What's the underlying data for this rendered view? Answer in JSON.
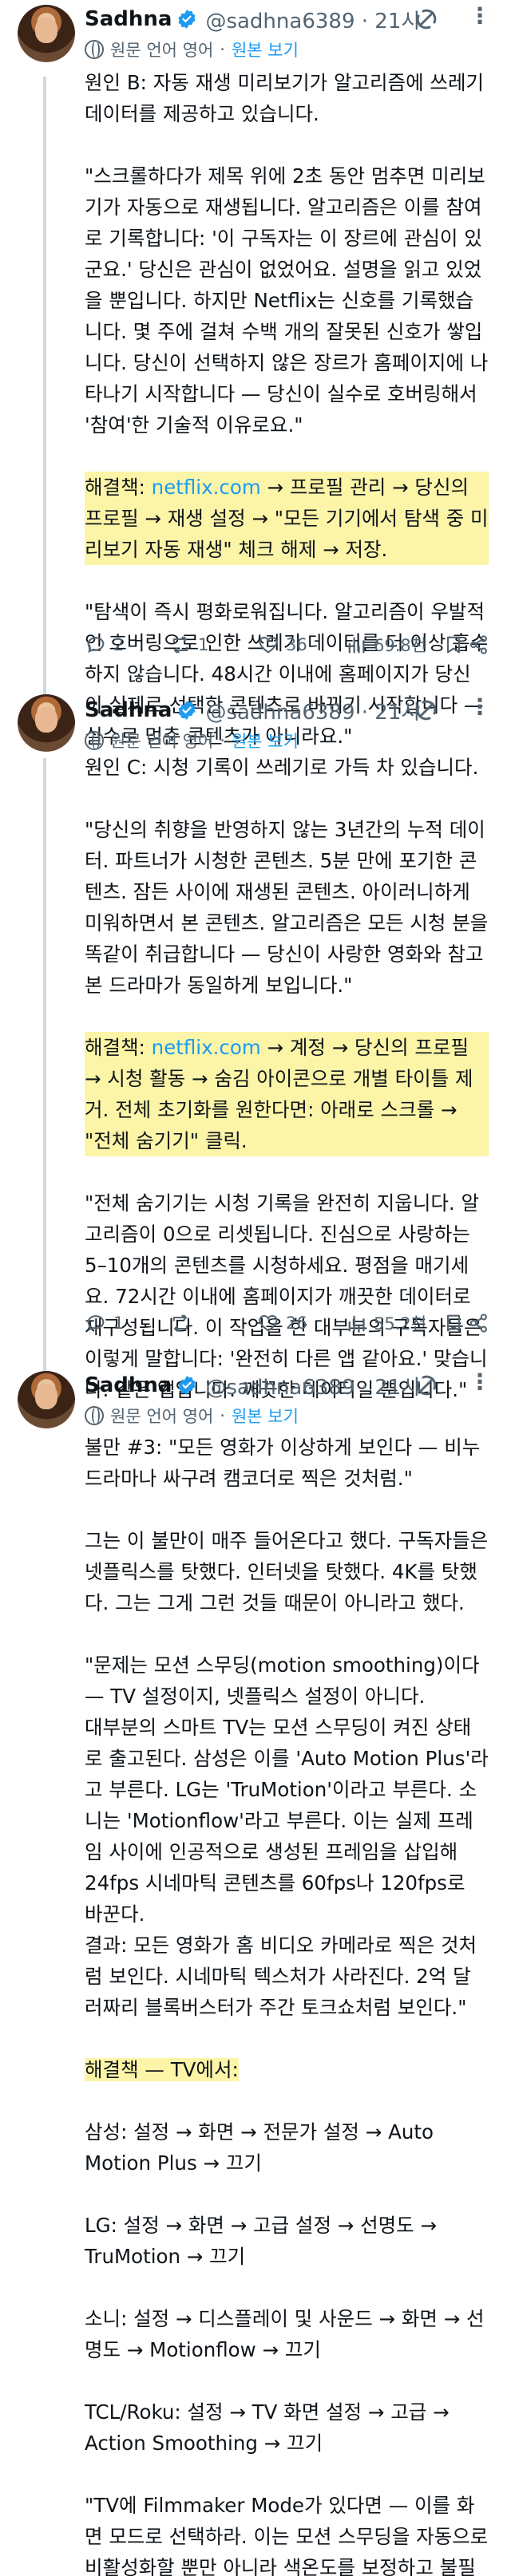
{
  "tweets": [
    {
      "name": "Sadhna",
      "handle": "@sadhna6389 · 21시",
      "translate": {
        "original": "원문 언어 영어",
        "show": "원본 보기"
      },
      "paragraphs": [
        "원인 B: 자동 재생 미리보기가 알고리즘에 쓰레기 데이터를 제공하고 있습니다.",
        "\"스크롤하다가 제목 위에 2초 동안 멈추면 미리보기가 자동으로 재생됩니다. 알고리즘은 이를 참여로 기록합니다: '이 구독자는 이 장르에 관심이 있군요.' 당신은 관심이 없었어요. 설명을 읽고 있었을 뿐입니다. 하지만 Netflix는 신호를 기록했습니다. 몇 주에 걸쳐 수백 개의 잘못된 신호가 쌓입니다. 당신이 선택하지 않은 장르가 홈페이지에 나타나기 시작합니다 — 당신이 실수로 호버링해서 '참여'한 기술적 이유로요.\""
      ],
      "fix": {
        "prefix": "해결책: ",
        "link": "netflix.com",
        "rest": " → 프로필 관리 → 당신의 프로필 → 재생 설정 → \"모든 기기에서 탐색 중 미리보기 자동 재생\" 체크 해제 → 저장."
      },
      "closing": "\"탐색이 즉시 평화로워집니다. 알고리즘이 우발적인 호버링으로 인한 쓰레기 데이터를 더 이상 흡수하지 않습니다. 48시간 이내에 홈페이지가 당신이 실제로 선택한 콘텐츠로 바뀌기 시작합니다 — 실수로 멈춘 콘텐츠가 아니라요.\"",
      "stats": {
        "replies": "2",
        "reposts": "1",
        "likes": "36",
        "views": "69.8천"
      }
    },
    {
      "name": "Sadhna",
      "handle": "@sadhna6389 · 21시",
      "translate": {
        "original": "원문 언어 영어",
        "show": "원본 보기"
      },
      "paragraphs": [
        "원인 C: 시청 기록이 쓰레기로 가득 차 있습니다.",
        "\"당신의 취향을 반영하지 않는 3년간의 누적 데이터. 파트너가 시청한 콘텐츠. 5분 만에 포기한 콘텐츠. 잠든 사이에 재생된 콘텐츠. 아이러니하게 미워하면서 본 콘텐츠. 알고리즘은 모든 시청 분을 똑같이 취급합니다 — 당신이 사랑한 영화와 참고 본 드라마가 동일하게 보입니다.\""
      ],
      "fix": {
        "prefix": "해결책: ",
        "link": "netflix.com",
        "rest": " → 계정 → 당신의 프로필 → 시청 활동 → 숨김 아이콘으로 개별 타이틀 제거. 전체 초기화를 원한다면: 아래로 스크롤 → \"전체 숨기기\" 클릭."
      },
      "closing": "\"전체 숨기기는 시청 기록을 완전히 지웁니다. 알고리즘이 0으로 리셋됩니다. 진심으로 사랑하는 5–10개의 콘텐츠를 시청하세요. 평점을 매기세요. 72시간 이내에 홈페이지가 깨끗한 데이터로 재구성됩니다. 이 작업을 한 대부분의 구독자들은 이렇게 말합니다: '완전히 다른 앱 같아요.' 맞습니다. 같은 앱입니다. 깨끗한 데이터일 뿐입니다.\"",
      "stats": {
        "replies": "1",
        "reposts": "",
        "likes": "26",
        "views": "55.2천"
      }
    },
    {
      "name": "Sadhna",
      "handle": "@sadhna6389 · 21시",
      "translate": {
        "original": "원문 언어 영어",
        "show": "원본 보기"
      },
      "paragraphs": [
        "불만 #3: \"모든 영화가 이상하게 보인다 — 비누 드라마나 싸구려 캠코더로 찍은 것처럼.\"",
        "그는 이 불만이 매주 들어온다고 했다. 구독자들은 넷플릭스를 탓했다. 인터넷을 탓했다. 4K를 탓했다. 그는 그게 그런 것들 때문이 아니라고 했다.",
        "\"문제는 모션 스무딩(motion smoothing)이다 — TV 설정이지, 넷플릭스 설정이 아니다.\n대부분의 스마트 TV는 모션 스무딩이 켜진 상태로 출고된다. 삼성은 이를 'Auto Motion Plus'라고 부른다. LG는 'TruMotion'이라고 부른다. 소니는 'Motionflow'라고 부른다. 이는 실제 프레임 사이에 인공적으로 생성된 프레임을 삽입해 24fps 시네마틱 콘텐츠를 60fps나 120fps로 바꾼다.\n결과: 모든 영화가 홈 비디오 카메라로 찍은 것처럼 보인다. 시네마틱 텍스처가 사라진다. 2억 달러짜리 블록버스터가 주간 토크쇼처럼 보인다.\""
      ],
      "fixLabel": "해결책 — TV에서:",
      "tvSettings": [
        "삼성: 설정 → 화면 → 전문가 설정 → Auto Motion Plus → 끄기",
        "LG: 설정 → 화면 → 고급 설정 → 선명도 → TruMotion → 끄기",
        "소니: 설정 → 디스플레이 및 사운드 → 화면 → 선명도 → Motionflow → 끄기",
        "TCL/Roku: 설정 → TV 화면 설정 → 고급 → Action Smoothing → 끄기"
      ],
      "closing": "\"TV에 Filmmaker Mode가 있다면 — 이를 화면 모드로 선택하라. 이는 모션 스무딩을 자동으로 비활성화할 뿐만 아니라 색온도를 보정하고 불필요한 처리를 끈다. 한 가지 설정. 비누 드라마 효과가 사라진다. 영화가 다시 영화처럼 보인다.\""
    }
  ],
  "colors": {
    "text": "#0f1419",
    "secondary": "#536471",
    "link": "#1d9bf0",
    "highlight": "#fcf5a8",
    "thread": "#cfd9de"
  },
  "icons": [
    "grok-icon",
    "more-icon",
    "translate-icon",
    "reply-icon",
    "repost-icon",
    "like-icon",
    "views-icon",
    "bookmark-icon",
    "share-icon"
  ]
}
